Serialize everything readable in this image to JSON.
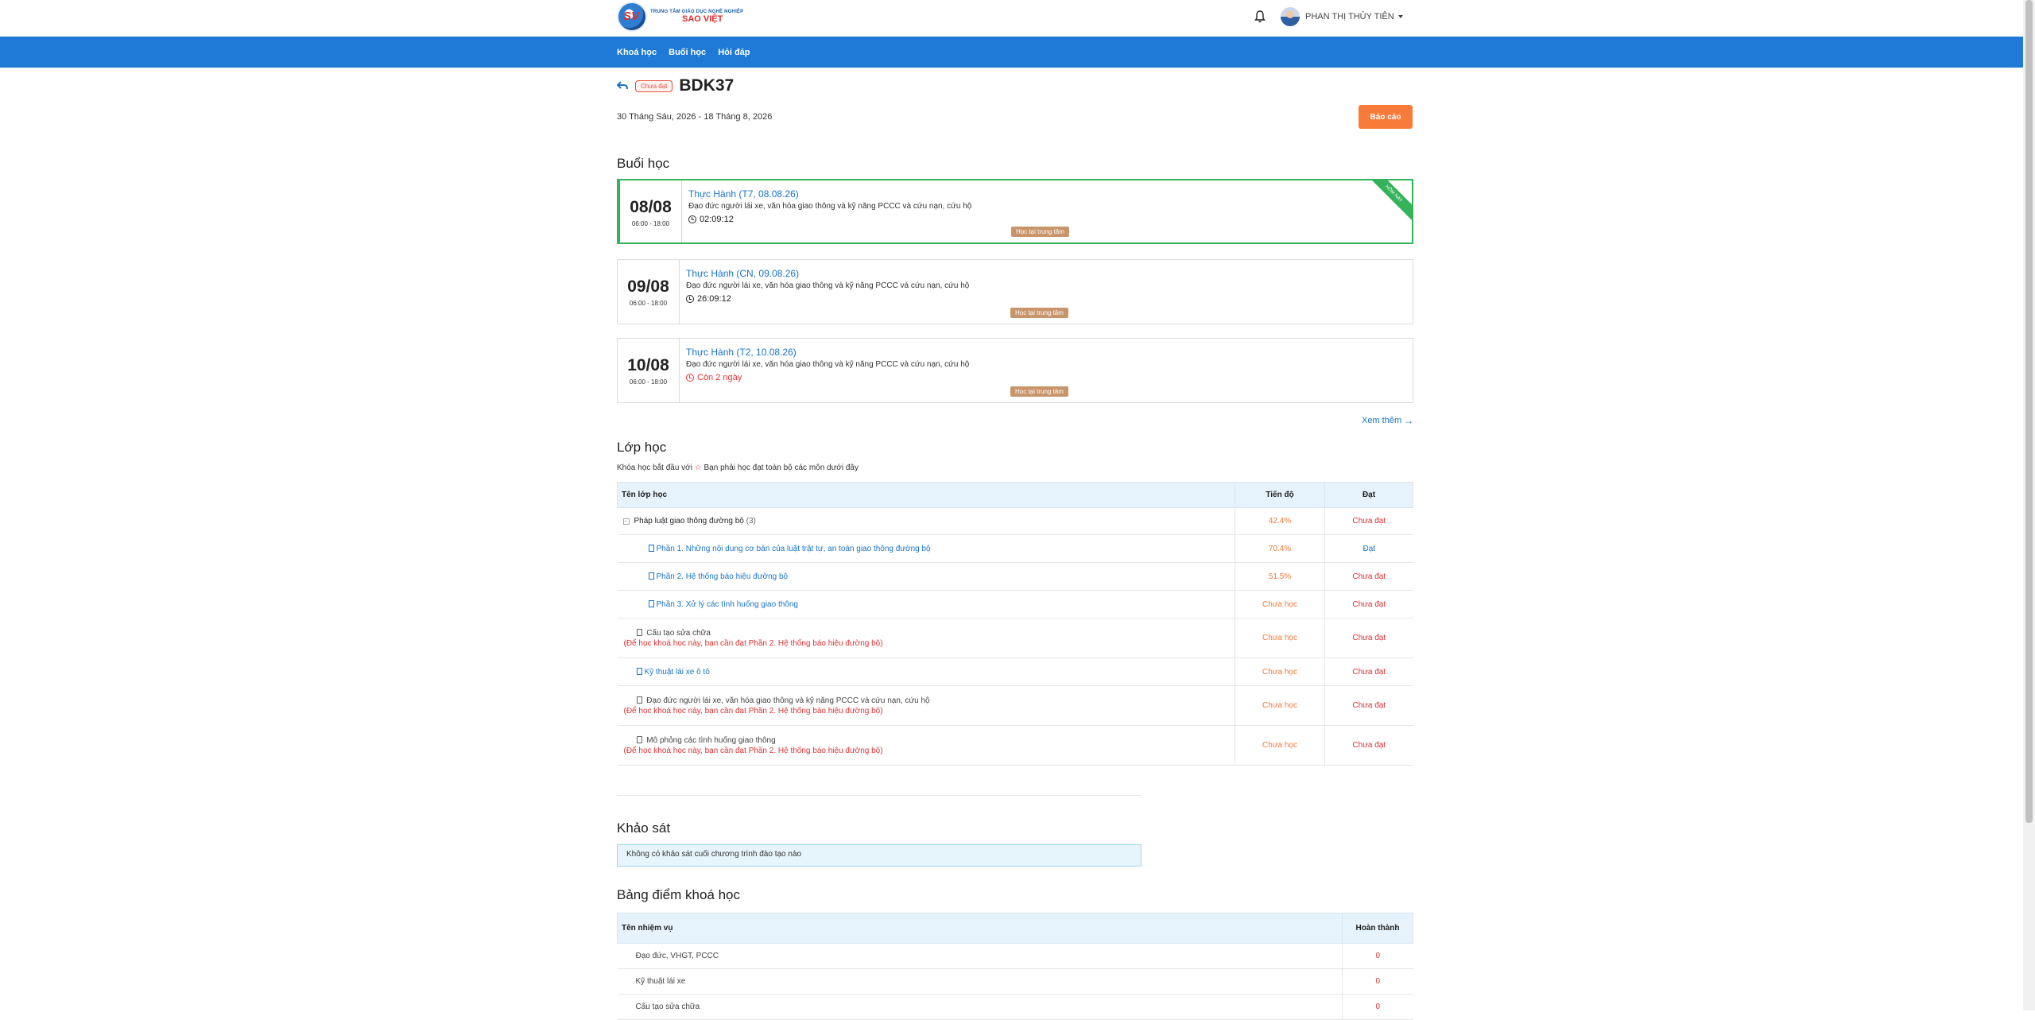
{
  "header": {
    "logo_mark": "SV",
    "logo_line1": "TRUNG TÂM GIÁO DỤC NGHỀ NGHIỆP",
    "logo_line2": "SAO VIỆT",
    "user_name": "PHAN THỊ THỦY TIÊN"
  },
  "nav": [
    "Khoá học",
    "Buổi học",
    "Hỏi đáp"
  ],
  "course": {
    "status": "Chưa đạt",
    "code": "BDK37",
    "date_range": "30 Tháng Sáu, 2026 - 18 Tháng 8, 2026",
    "report_label": "Báo cáo"
  },
  "sessions_title": "Buổi học",
  "sessions": [
    {
      "day": "08/08",
      "time": "06:00 - 18:00",
      "title": "Thực Hành (T7, 08.08.26)",
      "desc": "Đạo đức người lái xe, văn hóa giao thông và kỹ năng PCCC và cứu nạn, cứu hộ",
      "duration": "02:09:12",
      "location": "Học tại trung tâm",
      "ribbon": "HÔM NAY"
    },
    {
      "day": "09/08",
      "time": "06:00 - 18:00",
      "title": "Thực Hành (CN, 09.08.26)",
      "desc": "Đạo đức người lái xe, văn hóa giao thông và kỹ năng PCCC và cứu nạn, cứu hộ",
      "duration": "26:09:12",
      "location": "Học tại trung tâm"
    },
    {
      "day": "10/08",
      "time": "06:00 - 18:00",
      "title": "Thực Hành (T2, 10.08.26)",
      "desc": "Đạo đức người lái xe, văn hóa giao thông và kỹ năng PCCC và cứu nạn, cứu hộ",
      "duration": "Còn 2 ngày",
      "location": "Học tại trung tâm"
    }
  ],
  "more_label": "Xem thêm",
  "classes": {
    "title": "Lớp học",
    "note_before": "Khóa học bắt đầu với",
    "note_after": "Bạn phải học đạt toàn bộ các môn dưới đây",
    "headers": [
      "Tên lớp học",
      "Tiến độ",
      "Đạt"
    ],
    "group": {
      "name": "Pháp luật giao thông đường bộ",
      "count": "(3)",
      "progress": "42.4%",
      "result": "Chưa đạt"
    },
    "sub": [
      {
        "name": "Phần 1. Những nội dung cơ bản của luật trật tự, an toàn giao thông đường bộ",
        "progress": "70.4%",
        "result": "Đạt"
      },
      {
        "name": "Phần 2. Hệ thống báo hiệu đường bộ",
        "progress": "51.5%",
        "result": "Chưa đạt"
      },
      {
        "name": "Phần 3. Xử lý các tình huống giao thông",
        "progress": "Chưa học",
        "result": "Chưa đạt"
      }
    ],
    "items": [
      {
        "name": "Cấu tạo sửa chữa",
        "req": "(Để học khoá học này, bạn cần đạt Phần 2. Hệ thống báo hiệu đường bộ)",
        "progress": "Chưa học",
        "result": "Chưa đạt"
      },
      {
        "name": "Kỹ thuật lái xe ô tô",
        "req": "",
        "progress": "Chưa học",
        "result": "Chưa đạt"
      },
      {
        "name": "Đạo đức người lái xe, văn hóa giao thông và kỹ năng PCCC và cứu nạn, cứu hộ",
        "req": "(Để học khoá học này, bạn cần đạt Phần 2. Hệ thống báo hiệu đường bộ)",
        "progress": "Chưa học",
        "result": "Chưa đạt"
      },
      {
        "name": "Mô phỏng các tình huống giao thông",
        "req": "(Để học khoá học này, bạn cần đạt Phần 2. Hệ thống báo hiệu đường bộ)",
        "progress": "Chưa học",
        "result": "Chưa đạt"
      }
    ]
  },
  "survey": {
    "title": "Khảo sát",
    "message": "Không có khảo sát cuối chương trình đào tạo nào"
  },
  "grades": {
    "title": "Bảng điểm khoá học",
    "headers": [
      "Tên nhiệm vụ",
      "Hoàn thành"
    ],
    "rows": [
      {
        "name": "Đạo đức, VHGT, PCCC",
        "value": "0"
      },
      {
        "name": "Kỹ thuật lái xe",
        "value": "0"
      },
      {
        "name": "Cấu tạo sửa chữa",
        "value": "0"
      }
    ]
  }
}
